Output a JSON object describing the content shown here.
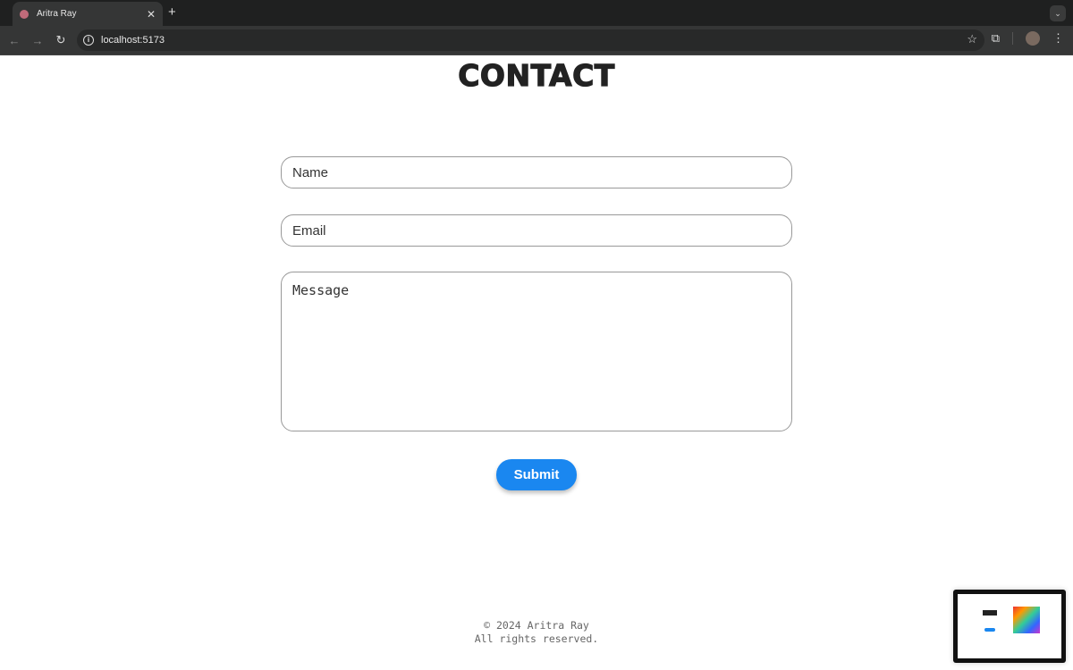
{
  "browser": {
    "tab_title": "Aritra Ray",
    "tab_close": "✕",
    "new_tab": "+",
    "url": "localhost:5173"
  },
  "page": {
    "heading": "CONTACT",
    "form": {
      "name_placeholder": "Name",
      "email_placeholder": "Email",
      "message_placeholder": "Message",
      "submit_label": "Submit"
    },
    "footer": {
      "copyright": "© 2024 Aritra Ray",
      "rights": "All rights reserved."
    }
  },
  "colors": {
    "accent": "#1a87f0",
    "heading": "#222222"
  }
}
